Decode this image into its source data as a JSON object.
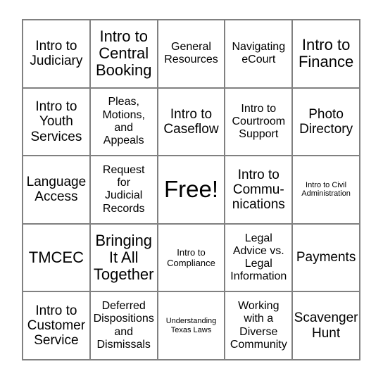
{
  "card": {
    "type": "bingo-card",
    "rows": 5,
    "columns": 5,
    "border_color": "#808080",
    "background_color": "#ffffff",
    "text_color": "#000000",
    "free_space": {
      "row": 3,
      "column": 3,
      "label": "Free!"
    },
    "cells": [
      [
        {
          "label": "Intro to\nJudiciary",
          "size": "md"
        },
        {
          "label": "Intro to\nCentral\nBooking",
          "size": "lg"
        },
        {
          "label": "General\nResources",
          "size": "sm"
        },
        {
          "label": "Navigating\neCourt",
          "size": "sm"
        },
        {
          "label": "Intro to\nFinance",
          "size": "lg"
        }
      ],
      [
        {
          "label": "Intro to\nYouth\nServices",
          "size": "md"
        },
        {
          "label": "Pleas,\nMotions,\nand\nAppeals",
          "size": "sm"
        },
        {
          "label": "Intro to\nCaseflow",
          "size": "md"
        },
        {
          "label": "Intro to\nCourtroom\nSupport",
          "size": "sm"
        },
        {
          "label": "Photo\nDirectory",
          "size": "md"
        }
      ],
      [
        {
          "label": "Language\nAccess",
          "size": "md"
        },
        {
          "label": "Request\nfor\nJudicial\nRecords",
          "size": "sm"
        },
        {
          "label": "Free!",
          "size": "xl"
        },
        {
          "label": "Intro to\nCommu-\nnications",
          "size": "md"
        },
        {
          "label": "Intro to Civil\nAdministration",
          "size": "xxs"
        }
      ],
      [
        {
          "label": "TMCEC",
          "size": "lg"
        },
        {
          "label": "Bringing\nIt All\nTogether",
          "size": "lg"
        },
        {
          "label": "Intro to\nCompliance",
          "size": "xs"
        },
        {
          "label": "Legal\nAdvice vs.\nLegal\nInformation",
          "size": "sm"
        },
        {
          "label": "Payments",
          "size": "md"
        }
      ],
      [
        {
          "label": "Intro to\nCustomer\nService",
          "size": "md"
        },
        {
          "label": "Deferred\nDispositions\nand\nDismissals",
          "size": "sm"
        },
        {
          "label": "Understanding\nTexas Laws",
          "size": "xxs"
        },
        {
          "label": "Working\nwith a\nDiverse\nCommunity",
          "size": "sm"
        },
        {
          "label": "Scavenger\nHunt",
          "size": "md"
        }
      ]
    ]
  }
}
